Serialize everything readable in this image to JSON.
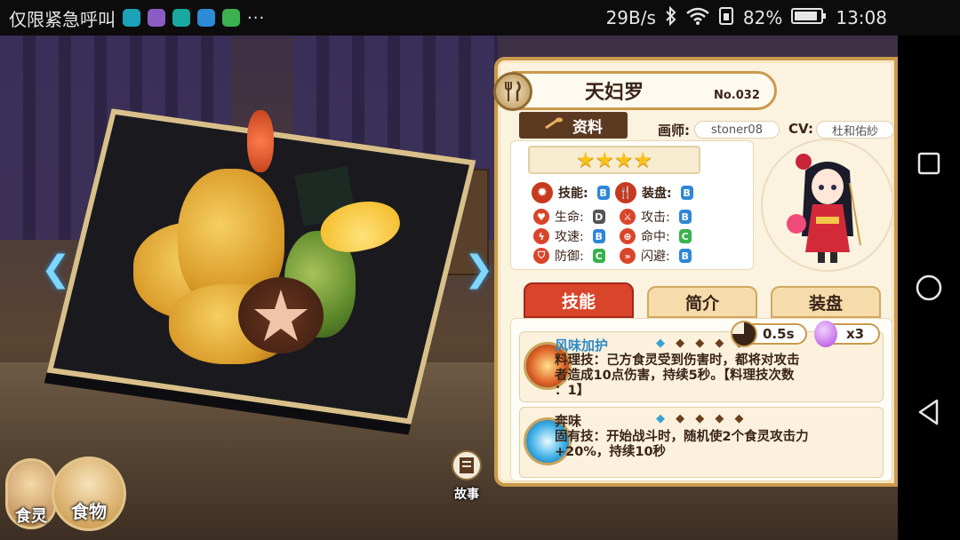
{
  "status_bar": {
    "carrier": "仅限紧急呼叫",
    "more": "···",
    "network_speed": "29B/s",
    "battery": "82%",
    "time": "13:08"
  },
  "scene": {
    "food_button": "食物",
    "spirit_button": "食灵",
    "story_button": "故事"
  },
  "panel": {
    "name": "天妇罗",
    "number": "No.032",
    "info_tab": "资料",
    "artist_label": "画师:",
    "artist": "stoner08",
    "cv_label": "CV:",
    "cv": "杜和佑紗",
    "stars": "★★★★",
    "stats": {
      "skill": {
        "label": "技能:",
        "grade": "B"
      },
      "plate": {
        "label": "装盘:",
        "grade": "B"
      },
      "hp": {
        "label": "生命:",
        "grade": "D"
      },
      "atk": {
        "label": "攻击:",
        "grade": "B"
      },
      "spd": {
        "label": "攻速:",
        "grade": "B"
      },
      "hit": {
        "label": "命中:",
        "grade": "C"
      },
      "def": {
        "label": "防御:",
        "grade": "C"
      },
      "dodge": {
        "label": "闪避:",
        "grade": "B"
      }
    },
    "tabs": {
      "skills": "技能",
      "intro": "简介",
      "equip": "装盘"
    },
    "skills": [
      {
        "name": "风味加护",
        "diamonds": "◆ ◆ ◆ ◆",
        "cooldown": "0.5s",
        "charges": "x3",
        "desc_line1": "料理技：己方食灵受到伤害时，都将对攻击",
        "desc_line2": "者造成10点伤害，持续5秒。【料理技次数",
        "desc_line3": "：1】"
      },
      {
        "name": "奔味",
        "diamonds": "◆ ◆ ◆ ◆",
        "desc_line1": "固有技：开始战斗时，随机使2个食灵攻击力",
        "desc_line2": "+20%，持续10秒"
      }
    ]
  },
  "colors": {
    "accent": "#c99a4c",
    "grade_b": "#2e86d6",
    "grade_c": "#36b34a",
    "grade_d": "#555555",
    "skill_tab_active": "#d9452a"
  }
}
